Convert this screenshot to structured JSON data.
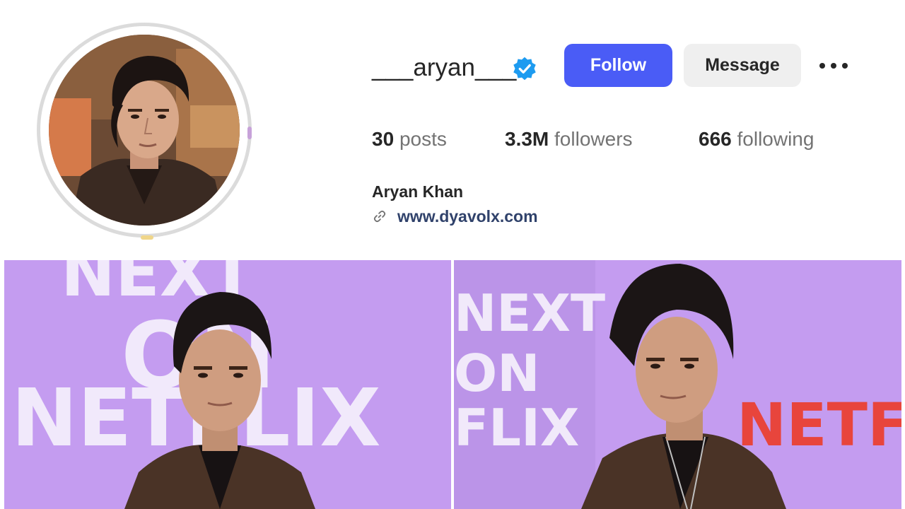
{
  "profile": {
    "username": "___aryan___",
    "verified": true,
    "full_name": "Aryan Khan",
    "website": "www.dyavolx.com",
    "avatar_alt": "profile-photo"
  },
  "actions": {
    "follow_label": "Follow",
    "message_label": "Message"
  },
  "stats": {
    "posts_count": "30",
    "posts_label": "posts",
    "followers_count": "3.3M",
    "followers_label": "followers",
    "following_count": "666",
    "following_label": "following"
  },
  "posts": {
    "post1_backdrop_text": [
      "NEXT",
      "ON",
      "NETFLIX"
    ],
    "post2_backdrop_text": [
      "NEXT",
      "ON",
      "FLIX",
      "NETFL"
    ]
  },
  "colors": {
    "follow_button": "#4a5cf6",
    "message_button": "#efefef",
    "verified_badge": "#1d9bf0",
    "post_backdrop": "#c49cf0",
    "netflix_red": "#e8453c"
  },
  "icons": [
    "verified-badge-icon",
    "more-options-icon",
    "link-icon"
  ]
}
